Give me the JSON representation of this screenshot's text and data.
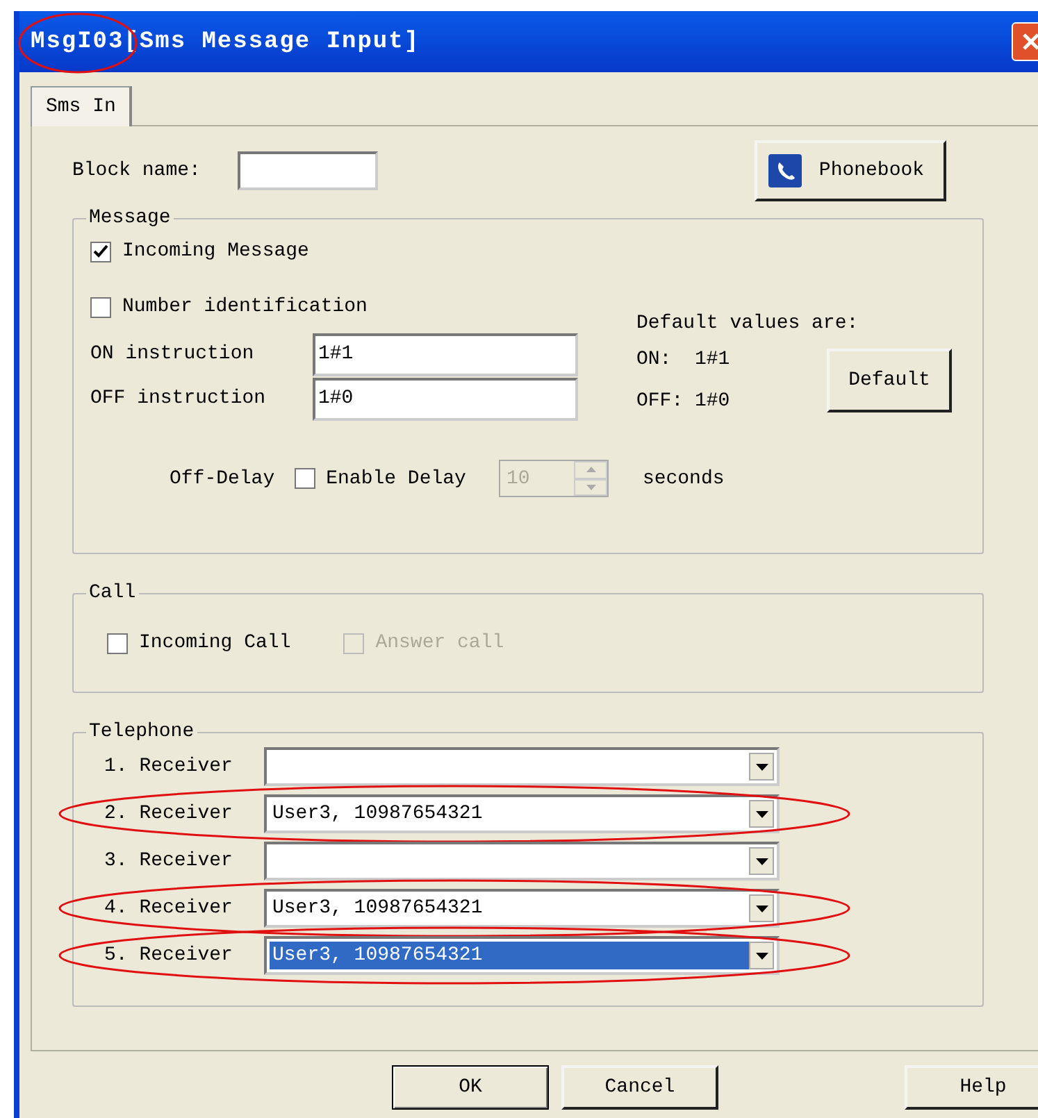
{
  "window": {
    "title": "MsgI03[Sms Message Input]",
    "title_circled": true
  },
  "tabs": [
    {
      "label": "Sms In",
      "selected": true
    }
  ],
  "block_name": {
    "label": "Block name:"
  },
  "phonebook_button": "Phonebook",
  "message": {
    "legend": "Message",
    "incoming_message": {
      "label": "Incoming Message",
      "checked": true
    },
    "number_identification": {
      "label": "Number identification",
      "checked": false
    },
    "on_instruction": {
      "label": "ON instruction",
      "value": "1#1"
    },
    "off_instruction": {
      "label": "OFF instruction",
      "value": "1#0"
    },
    "defaults_heading": "Default values are:",
    "default_on": {
      "label": "ON:",
      "value": "1#1"
    },
    "default_off": {
      "label": "OFF:",
      "value": "1#0"
    },
    "default_button": "Default",
    "off_delay": {
      "label": "Off-Delay",
      "checkbox": {
        "label": "Enable Delay",
        "checked": false
      },
      "spin_value": "10",
      "spin_disabled": true,
      "unit": "seconds"
    }
  },
  "call": {
    "legend": "Call",
    "checkboxes": [
      {
        "label": "Incoming Call",
        "checked": false,
        "disabled": false
      },
      {
        "label": "Answer call",
        "checked": false,
        "disabled": true
      }
    ]
  },
  "telephone": {
    "legend": "Telephone",
    "receivers": [
      {
        "label": "1. Receiver",
        "selected": false,
        "circled": false
      },
      {
        "label": "2. Receiver",
        "value": "User3, 10987654321",
        "selected": false,
        "circled": true
      },
      {
        "label": "3. Receiver",
        "selected": false,
        "circled": false
      },
      {
        "label": "4. Receiver",
        "value": "User3, 10987654321",
        "selected": false,
        "circled": true
      },
      {
        "label": "5. Receiver",
        "value": "User3, 10987654321",
        "selected": true,
        "circled": true
      }
    ]
  },
  "buttons": [
    {
      "label": "OK",
      "kind": "default"
    },
    {
      "label": "Cancel",
      "kind": "normal"
    },
    {
      "label": "Help",
      "kind": "help"
    }
  ]
}
